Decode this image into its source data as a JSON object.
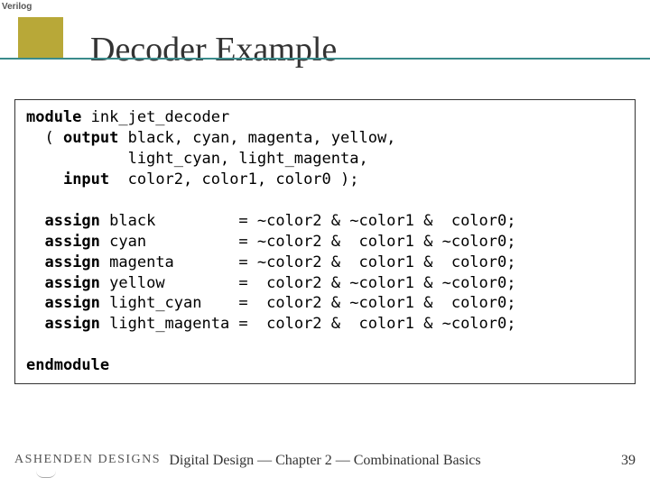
{
  "badge": "Verilog",
  "title": "Decoder Example",
  "code": {
    "line1a": "module",
    "line1b": " ink_jet_decoder",
    "line2a": "  ( ",
    "line2b": "output",
    "line2c": " black, cyan, magenta, yellow,",
    "line3": "           light_cyan, light_magenta,",
    "line4a": "    ",
    "line4b": "input",
    "line4c": "  color2, color1, color0 );",
    "assign": "assign",
    "a1": " black         = ~color2 & ~color1 &  color0;",
    "a2": " cyan          = ~color2 &  color1 & ~color0;",
    "a3": " magenta       = ~color2 &  color1 &  color0;",
    "a4": " yellow        =  color2 & ~color1 & ~color0;",
    "a5": " light_cyan    =  color2 & ~color1 &  color0;",
    "a6": " light_magenta =  color2 &  color1 & ~color0;",
    "end": "endmodule"
  },
  "logo": "ASHENDEN DESIGNS",
  "footer": "Digital Design — Chapter 2 — Combinational Basics",
  "page": "39"
}
